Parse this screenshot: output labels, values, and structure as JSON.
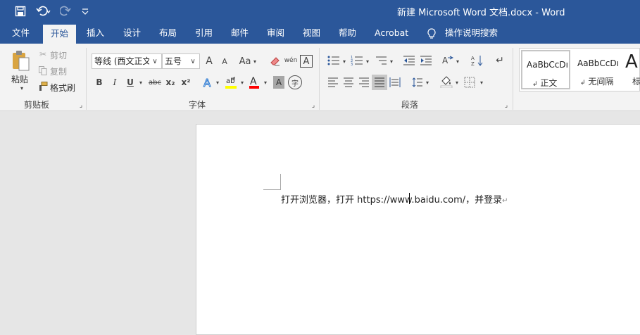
{
  "titlebar": {
    "title": "新建 Microsoft Word 文档.docx  -  Word",
    "save_icon": "save-icon",
    "undo_icon": "undo-icon",
    "redo_icon": "redo-icon",
    "customize_icon": "customize-qat-icon"
  },
  "tabs": [
    {
      "label": "文件"
    },
    {
      "label": "开始"
    },
    {
      "label": "插入"
    },
    {
      "label": "设计"
    },
    {
      "label": "布局"
    },
    {
      "label": "引用"
    },
    {
      "label": "邮件"
    },
    {
      "label": "审阅"
    },
    {
      "label": "视图"
    },
    {
      "label": "帮助"
    },
    {
      "label": "Acrobat"
    },
    {
      "label": "操作说明搜索"
    }
  ],
  "clipboard": {
    "paste": "粘贴",
    "cut": "剪切",
    "copy": "复制",
    "format_painter": "格式刷",
    "group": "剪贴板"
  },
  "font": {
    "name": "等线 (西文正文)",
    "size": "五号",
    "group": "字体",
    "bold": "B",
    "italic": "I",
    "underline": "U",
    "strike": "abc",
    "subscript": "x₂",
    "superscript": "x²",
    "case": "Aa",
    "grow": "A",
    "shrink": "A",
    "phonetic": "wén",
    "char_border": "A",
    "char_shade": "A",
    "enclose": "字"
  },
  "paragraph": {
    "group": "段落"
  },
  "styles": [
    {
      "sample": "AaBbCcDı",
      "name": "正文"
    },
    {
      "sample": "AaBbCcDı",
      "name": "无间隔"
    },
    {
      "sample": "A",
      "name": "标"
    }
  ],
  "document": {
    "text": "打开浏览器，打开  https://www.baidu.com/，并登录",
    "paragraph_mark": "↵"
  },
  "colors": {
    "brand": "#2b579a",
    "highlight": "#ffff00",
    "font_color": "#ff0000"
  }
}
